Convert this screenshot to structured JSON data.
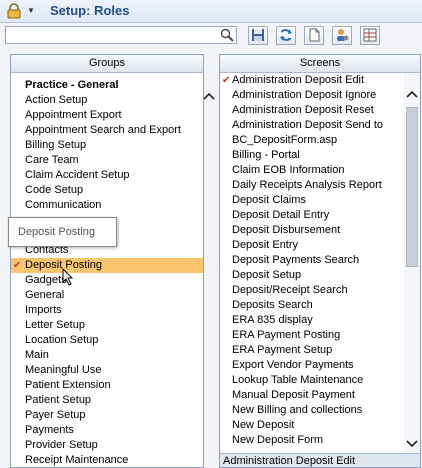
{
  "window": {
    "title": "Setup: Roles"
  },
  "toolbar": {
    "search_value": "",
    "search_placeholder": ""
  },
  "groups": {
    "header": "Groups",
    "heading": "Practice - General",
    "items_top": [
      "Action Setup",
      "Appointment Export",
      "Appointment Search and Export",
      "Billing Setup",
      "Care Team",
      "Claim Accident Setup",
      "Code Setup",
      "Communication"
    ],
    "items_mid": [
      "Contacts"
    ],
    "selected": "Deposit Posting",
    "items_bottom": [
      "Gadgets",
      "General",
      "Imports",
      "Letter Setup",
      "Location Setup",
      "Main",
      "Meaningful Use",
      "Patient Extension",
      "Patient Setup",
      "Payer Setup",
      "Payments",
      "Provider Setup",
      "Receipt Maintenance"
    ]
  },
  "tooltip": {
    "text": "Deposit Posting"
  },
  "screens": {
    "header": "Screens",
    "items": [
      "Administration Deposit Edit",
      "Administration Deposit Ignore",
      "Administration Deposit Reset",
      "Administration Deposit Send to",
      "BC_DepositForm.asp",
      "Billing - Portal",
      "Claim EOB Information",
      "Daily Receipts Analysis Report",
      "Deposit Claims",
      "Deposit Detail Entry",
      "Deposit Disbursement",
      "Deposit Entry",
      "Deposit Payments Search",
      "Deposit Setup",
      "Deposit/Receipt Search",
      "Deposits Search",
      "ERA 835 display",
      "ERA Payment Posting",
      "ERA Payment Setup",
      "Export Vendor Payments",
      "Lookup Table Maintenance",
      "Manual Deposit Payment",
      "New Billing and collections",
      "New Deposit",
      "New Deposit Form"
    ],
    "status": "Administration Deposit Edit"
  }
}
